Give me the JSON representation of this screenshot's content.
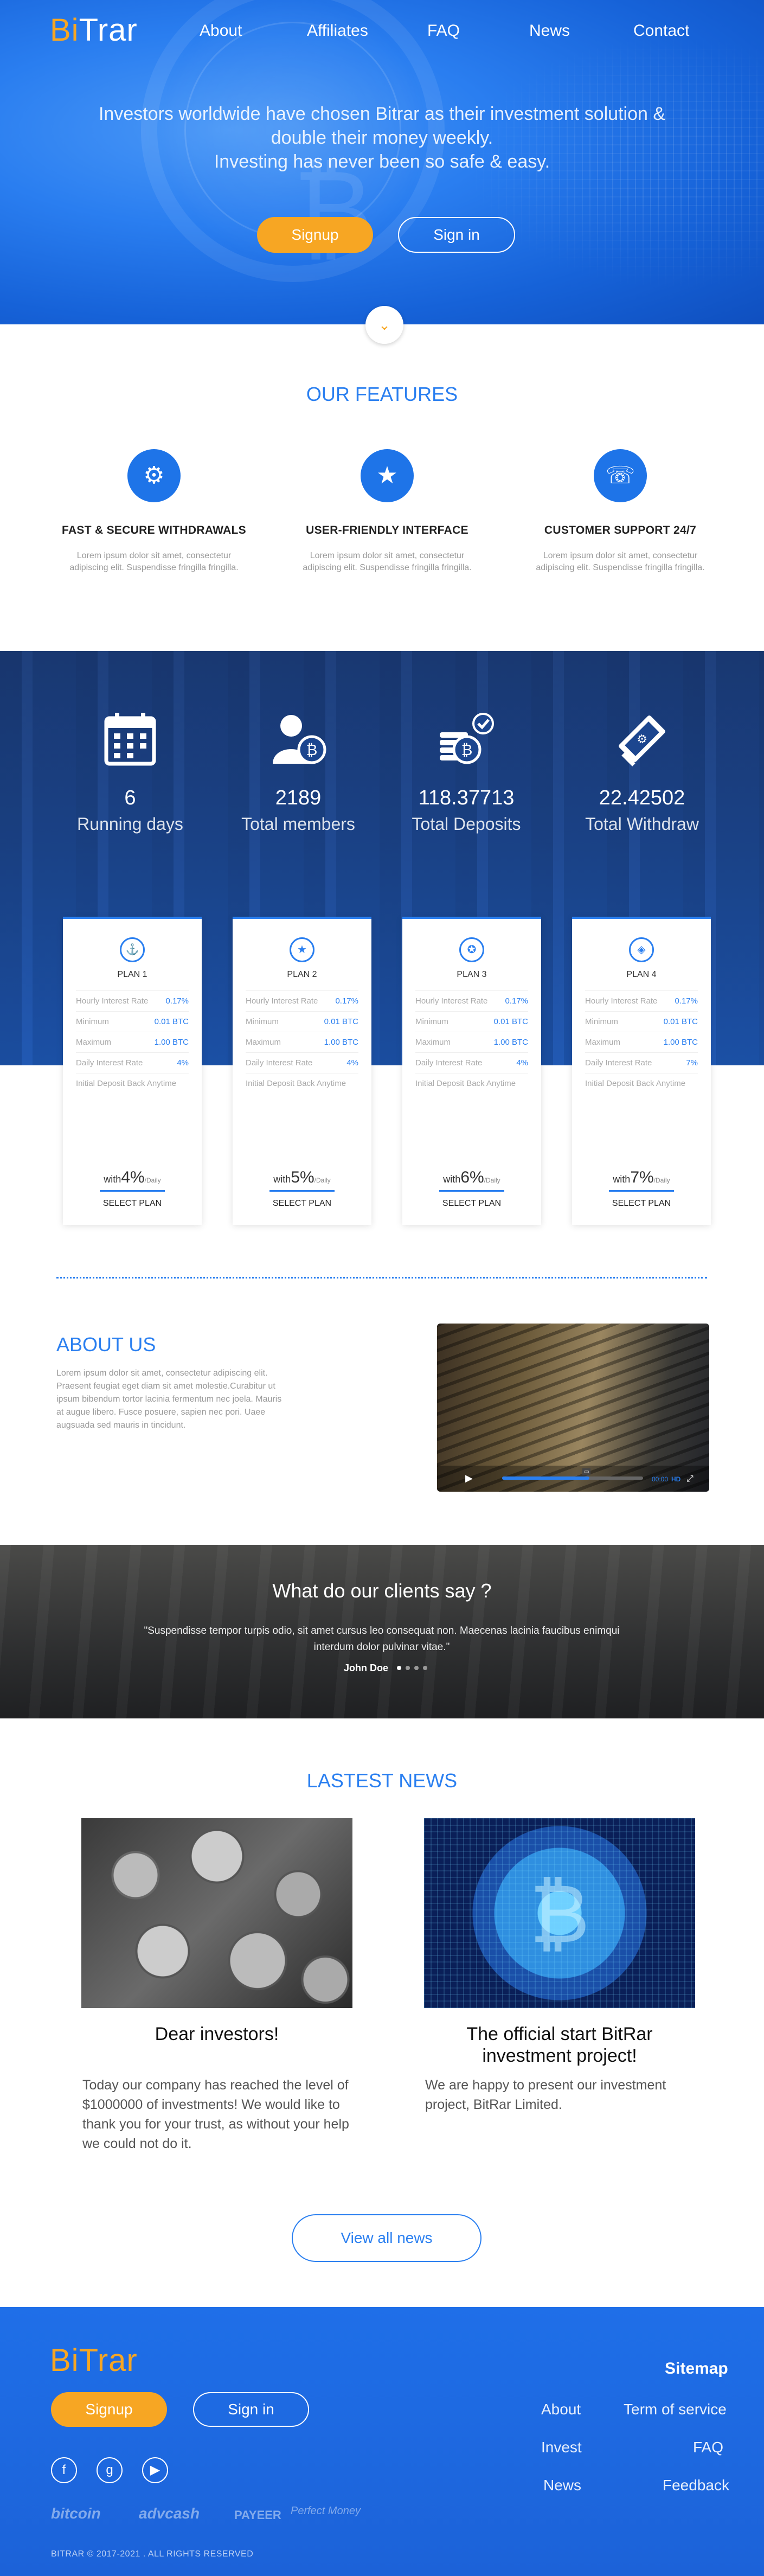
{
  "brand": {
    "logo_part1": "Bi",
    "logo_part2": "Trar",
    "accent": "#f6a623",
    "primary": "#2a7ff0"
  },
  "nav": {
    "about": "About",
    "affiliates": "Affiliates",
    "faq": "FAQ",
    "news": "News",
    "contact": "Contact"
  },
  "hero": {
    "line1": "Investors worldwide have chosen Bitrar as their investment solution &",
    "line2": "double their money weekly.",
    "line3": "Investing has never been so safe & easy.",
    "signup": "Signup",
    "signin": "Sign in",
    "scroll_icon": "chevron-down-icon"
  },
  "features": {
    "title": "OUR FEATURES",
    "items": [
      {
        "icon": "gear-icon",
        "title": "FAST & SECURE WITHDRAWALS",
        "desc": "Lorem ipsum dolor sit amet, consectetur adipiscing elit. Suspendisse fringilla fringilla."
      },
      {
        "icon": "star-icon",
        "title": "USER-FRIENDLY INTERFACE",
        "desc": "Lorem ipsum dolor sit amet, consectetur adipiscing elit. Suspendisse fringilla fringilla."
      },
      {
        "icon": "support-icon",
        "title": "CUSTOMER SUPPORT 24/7",
        "desc": "Lorem ipsum dolor sit amet, consectetur adipiscing elit. Suspendisse fringilla fringilla."
      }
    ]
  },
  "stats": [
    {
      "icon": "calendar-icon",
      "value": "6",
      "label": "Running days"
    },
    {
      "icon": "members-icon",
      "value": "2189",
      "label": "Total members"
    },
    {
      "icon": "coins-icon",
      "value": "118.37713",
      "label": "Total Deposits"
    },
    {
      "icon": "withdraw-icon",
      "value": "22.42502",
      "label": "Total Withdraw"
    }
  ],
  "plans": [
    {
      "name": "PLAN 1",
      "hourly": "0.17%",
      "minimum": "0.01 BTC",
      "maximum": "1.00 BTC",
      "daily": "4%",
      "with_prefix": "with",
      "with_value": "4%",
      "with_suffix": "/Daily",
      "select": "SELECT PLAN"
    },
    {
      "name": "PLAN 2",
      "hourly": "0.17%",
      "minimum": "0.01 BTC",
      "maximum": "1.00 BTC",
      "daily": "4%",
      "with_prefix": "with",
      "with_value": "5%",
      "with_suffix": "/Daily",
      "select": "SELECT PLAN"
    },
    {
      "name": "PLAN 3",
      "hourly": "0.17%",
      "minimum": "0.01 BTC",
      "maximum": "1.00 BTC",
      "daily": "4%",
      "with_prefix": "with",
      "with_value": "6%",
      "with_suffix": "/Daily",
      "select": "SELECT PLAN"
    },
    {
      "name": "PLAN 4",
      "hourly": "0.17%",
      "minimum": "0.01 BTC",
      "maximum": "1.00 BTC",
      "daily": "7%",
      "with_prefix": "with",
      "with_value": "7%",
      "with_suffix": "/Daily",
      "select": "SELECT PLAN"
    }
  ],
  "plan_labels": {
    "hourly": "Hourly Interest Rate",
    "minimum": "Minimum",
    "maximum": "Maximum",
    "daily": "Daily Interest Rate",
    "deposit_back": "Initial Deposit Back Anytime"
  },
  "about": {
    "title": "ABOUT US",
    "text": "Lorem ipsum dolor sit amet, consectetur adipiscing elit. Praesent feugiat eget diam sit amet molestie.Curabitur ut ipsum bibendum tortor lacinia fermentum nec joela. Mauris at augue libero. Fusce posuere, sapien nec pori. Uaee augsuada sed mauris in tincidunt.",
    "video_time": "00:00",
    "video_hd": "HD",
    "video_progress": 0.62
  },
  "testimonial": {
    "title": "What do our clients say ?",
    "quote": "\"Suspendisse tempor turpis odio, sit amet cursus leo consequat non. Maecenas lacinia faucibus enimqui interdum dolor pulvinar vitae.\"",
    "name": "John Doe"
  },
  "news": {
    "title": "LASTEST NEWS",
    "items": [
      {
        "title": "Dear investors!",
        "text": "Today our company has reached the level of $1000000 of investments! We would like to thank you for your trust, as without your help we could not do it."
      },
      {
        "title": "The official start BitRar investment project!",
        "text": "We are happy to present our investment project, BitRar Limited."
      }
    ],
    "view_all": "View all news"
  },
  "footer": {
    "signup": "Signup",
    "signin": "Sign in",
    "sitemap": "Sitemap",
    "links": {
      "about": "About",
      "terms": "Term of service",
      "invest": "Invest",
      "faq": "FAQ",
      "news": "News",
      "feedback": "Feedback"
    },
    "payments": [
      "bitcoin",
      "advcash",
      "PAYEER",
      "Perfect Money"
    ],
    "copyright": "BITRAR © 2017-2021 . ALL RIGHTS RESERVED"
  }
}
